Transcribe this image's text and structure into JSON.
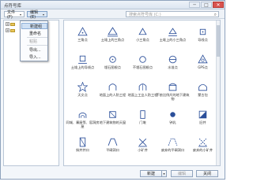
{
  "window": {
    "title": "点符号库",
    "min_glyph": "─",
    "max_glyph": "□",
    "close_glyph": "✕"
  },
  "toolbar": {
    "file_label": "文件(F)",
    "edit_label": "编辑(E)",
    "dropdown_glyph": "▾",
    "search_placeholder": "搜索点符号库 (C:)",
    "search_glyph": "⌕"
  },
  "tree": {
    "expand_glyph": "+"
  },
  "context_menu": {
    "items": [
      {
        "label": "新建组",
        "state": "highlighted"
      },
      {
        "label": "重命名",
        "state": "normal"
      },
      {
        "label": "粘贴",
        "state": "disabled"
      },
      {
        "label": "导出...",
        "state": "normal"
      },
      {
        "label": "导入...",
        "state": "normal"
      }
    ]
  },
  "symbols": [
    {
      "label": "三角点",
      "icon": "triangle-dot"
    },
    {
      "label": "土堆上的三角点",
      "icon": "mound-triangle"
    },
    {
      "label": "小三角点",
      "icon": "small-triangle"
    },
    {
      "label": "土堆上的小三角点",
      "icon": "mound-small-triangle"
    },
    {
      "label": "导线点",
      "icon": "traverse-point"
    },
    {
      "label": "土堆上的导线点",
      "icon": "mound-traverse"
    },
    {
      "label": "埋石图根点",
      "icon": "buried-stone-control"
    },
    {
      "label": "不埋石图根点",
      "icon": "unburied-control"
    },
    {
      "label": "水准点",
      "icon": "benchmark"
    },
    {
      "label": "GPS点",
      "icon": "gps-point"
    },
    {
      "label": "天文点",
      "icon": "astronomical-point"
    },
    {
      "label": "地面上的人防工程",
      "icon": "ground-shelter"
    },
    {
      "label": "地面上工业人防工程",
      "icon": "industrial-shelter"
    },
    {
      "label": "不依比例尺的地下建筑物",
      "icon": "underground-building"
    },
    {
      "label": "蒙古包",
      "icon": "yurt"
    },
    {
      "label": "同城、寨屋等、窑洞房屋",
      "icon": "cave-dwelling"
    },
    {
      "label": "地下建筑物的天窗",
      "icon": "skylight"
    },
    {
      "label": "门墩",
      "icon": "gate-pier"
    },
    {
      "label": "钟乳",
      "icon": "stalactite"
    },
    {
      "label": "旧井",
      "icon": "old-well"
    },
    {
      "label": "斜井井口",
      "icon": "incline-shaft"
    },
    {
      "label": "平硐洞口",
      "icon": "adit"
    },
    {
      "label": "小矿井",
      "icon": "small-mine"
    },
    {
      "label": "废弃的平硐洞口",
      "icon": "abandoned-adit"
    },
    {
      "label": "废弃的小矿井",
      "icon": "abandoned-mine"
    }
  ],
  "footer": {
    "new_label": "新建",
    "dropdown_glyph": "▾",
    "edit_label": "编辑",
    "close_label": "关闭"
  }
}
